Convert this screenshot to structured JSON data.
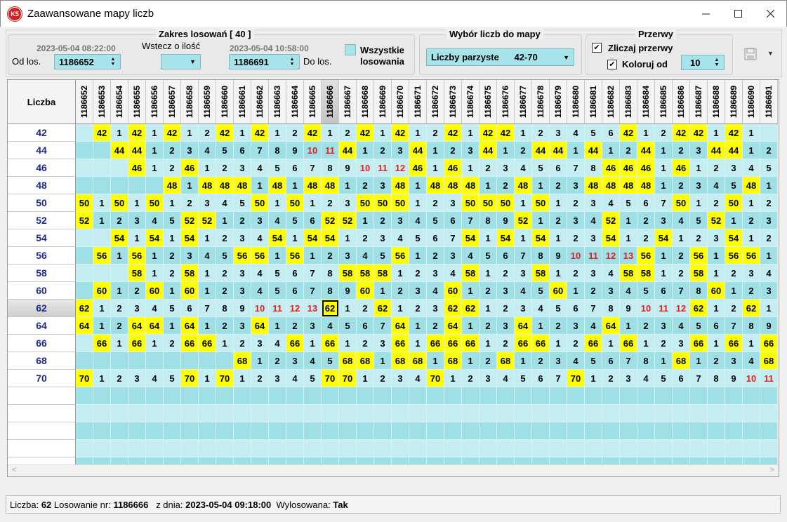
{
  "window": {
    "title": "Zaawansowane mapy liczb",
    "app_icon_text": "K5"
  },
  "range_panel": {
    "title": "Zakres losowań  [ 40 ]",
    "from_date": "2023-05-04 08:22:00",
    "from_label": "Od los.",
    "from_value": "1186652",
    "back_label": "Wstecz o ilość",
    "back_value": "",
    "to_date": "2023-05-04 10:58:00",
    "to_value": "1186691",
    "to_label": "Do los.",
    "all_label_1": "Wszystkie",
    "all_label_2": "losowania"
  },
  "numbers_panel": {
    "title": "Wybór liczb do mapy",
    "selected": "Liczby parzyste      42-70"
  },
  "gaps_panel": {
    "title": "Przerwy",
    "count_gaps_label": "Zliczaj przerwy",
    "count_gaps_checked": true,
    "color_from_label": "Koloruj od",
    "color_from_checked": true,
    "color_from_value": "10"
  },
  "grid": {
    "corner_label": "Liczba",
    "columns": [
      "1186652",
      "1186653",
      "1186654",
      "1186655",
      "1186656",
      "1186657",
      "1186658",
      "1186659",
      "1186660",
      "1186661",
      "1186662",
      "1186663",
      "1186664",
      "1186665",
      "1186666",
      "1186667",
      "1186668",
      "1186669",
      "1186670",
      "1186671",
      "1186672",
      "1186673",
      "1186674",
      "1186675",
      "1186676",
      "1186677",
      "1186678",
      "1186679",
      "1186680",
      "1186681",
      "1186682",
      "1186683",
      "1186684",
      "1186685",
      "1186686",
      "1186687",
      "1186688",
      "1186689",
      "1186690",
      "1186691"
    ],
    "selected_column": 14,
    "selected_row": 10,
    "color_threshold": 10,
    "rows": [
      {
        "num": "42",
        "cells": [
          "",
          "42",
          "1",
          "42",
          "1",
          "42",
          "1",
          "2",
          "42",
          "1",
          "42",
          "1",
          "2",
          "42",
          "1",
          "2",
          "42",
          "1",
          "42",
          "1",
          "2",
          "42",
          "1",
          "42",
          "42",
          "1",
          "2",
          "3",
          "4",
          "5",
          "6",
          "42",
          "1",
          "2",
          "42",
          "42",
          "1",
          "42",
          "1",
          ""
        ]
      },
      {
        "num": "44",
        "cells": [
          "",
          "",
          "44",
          "44",
          "1",
          "2",
          "3",
          "4",
          "5",
          "6",
          "7",
          "8",
          "9",
          "10",
          "11",
          "44",
          "1",
          "2",
          "3",
          "44",
          "1",
          "2",
          "3",
          "44",
          "1",
          "2",
          "44",
          "44",
          "1",
          "44",
          "1",
          "2",
          "44",
          "1",
          "2",
          "3",
          "44",
          "44",
          "1",
          "2"
        ]
      },
      {
        "num": "46",
        "cells": [
          "",
          "",
          "",
          "46",
          "1",
          "2",
          "46",
          "1",
          "2",
          "3",
          "4",
          "5",
          "6",
          "7",
          "8",
          "9",
          "10",
          "11",
          "12",
          "46",
          "1",
          "46",
          "1",
          "2",
          "3",
          "4",
          "5",
          "6",
          "7",
          "8",
          "46",
          "46",
          "46",
          "1",
          "46",
          "1",
          "2",
          "3",
          "4",
          "5"
        ]
      },
      {
        "num": "48",
        "cells": [
          "",
          "",
          "",
          "",
          "",
          "48",
          "1",
          "48",
          "48",
          "48",
          "1",
          "48",
          "1",
          "48",
          "48",
          "1",
          "2",
          "3",
          "48",
          "1",
          "48",
          "48",
          "48",
          "1",
          "2",
          "48",
          "1",
          "2",
          "3",
          "48",
          "48",
          "48",
          "48",
          "1",
          "2",
          "3",
          "4",
          "5",
          "48",
          "1"
        ]
      },
      {
        "num": "50",
        "cells": [
          "50",
          "1",
          "50",
          "1",
          "50",
          "1",
          "2",
          "3",
          "4",
          "5",
          "50",
          "1",
          "50",
          "1",
          "2",
          "3",
          "50",
          "50",
          "50",
          "1",
          "2",
          "3",
          "50",
          "50",
          "50",
          "1",
          "50",
          "1",
          "2",
          "3",
          "4",
          "5",
          "6",
          "7",
          "50",
          "1",
          "2",
          "50",
          "1",
          "2"
        ]
      },
      {
        "num": "52",
        "cells": [
          "52",
          "1",
          "2",
          "3",
          "4",
          "5",
          "52",
          "52",
          "1",
          "2",
          "3",
          "4",
          "5",
          "6",
          "52",
          "52",
          "1",
          "2",
          "3",
          "4",
          "5",
          "6",
          "7",
          "8",
          "9",
          "52",
          "1",
          "2",
          "3",
          "4",
          "52",
          "1",
          "2",
          "3",
          "4",
          "5",
          "52",
          "1",
          "2",
          "3"
        ]
      },
      {
        "num": "54",
        "cells": [
          "",
          "",
          "54",
          "1",
          "54",
          "1",
          "54",
          "1",
          "2",
          "3",
          "4",
          "54",
          "1",
          "54",
          "54",
          "1",
          "2",
          "3",
          "4",
          "5",
          "6",
          "7",
          "54",
          "1",
          "54",
          "1",
          "54",
          "1",
          "2",
          "3",
          "54",
          "1",
          "2",
          "54",
          "1",
          "2",
          "3",
          "54",
          "1",
          "2"
        ]
      },
      {
        "num": "56",
        "cells": [
          "",
          "56",
          "1",
          "56",
          "1",
          "2",
          "3",
          "4",
          "5",
          "56",
          "56",
          "1",
          "56",
          "1",
          "2",
          "3",
          "4",
          "5",
          "56",
          "1",
          "2",
          "3",
          "4",
          "5",
          "6",
          "7",
          "8",
          "9",
          "10",
          "11",
          "12",
          "13",
          "56",
          "1",
          "2",
          "56",
          "1",
          "56",
          "56",
          "1"
        ]
      },
      {
        "num": "58",
        "cells": [
          "",
          "",
          "",
          "58",
          "1",
          "2",
          "58",
          "1",
          "2",
          "3",
          "4",
          "5",
          "6",
          "7",
          "8",
          "58",
          "58",
          "58",
          "1",
          "2",
          "3",
          "4",
          "58",
          "1",
          "2",
          "3",
          "58",
          "1",
          "2",
          "3",
          "4",
          "58",
          "58",
          "1",
          "2",
          "58",
          "1",
          "2",
          "3",
          "4"
        ]
      },
      {
        "num": "60",
        "cells": [
          "",
          "60",
          "1",
          "2",
          "60",
          "1",
          "60",
          "1",
          "2",
          "3",
          "4",
          "5",
          "6",
          "7",
          "8",
          "9",
          "60",
          "1",
          "2",
          "3",
          "4",
          "60",
          "1",
          "2",
          "3",
          "4",
          "5",
          "60",
          "1",
          "2",
          "3",
          "4",
          "5",
          "6",
          "7",
          "8",
          "60",
          "1",
          "2",
          "3"
        ]
      },
      {
        "num": "62",
        "cells": [
          "62",
          "1",
          "2",
          "3",
          "4",
          "5",
          "6",
          "7",
          "8",
          "9",
          "10",
          "11",
          "12",
          "13",
          "62",
          "1",
          "2",
          "62",
          "1",
          "2",
          "3",
          "62",
          "62",
          "1",
          "2",
          "3",
          "4",
          "5",
          "6",
          "7",
          "8",
          "9",
          "10",
          "11",
          "12",
          "62",
          "1",
          "2",
          "62",
          "1"
        ]
      },
      {
        "num": "64",
        "cells": [
          "64",
          "1",
          "2",
          "64",
          "64",
          "1",
          "64",
          "1",
          "2",
          "3",
          "64",
          "1",
          "2",
          "3",
          "4",
          "5",
          "6",
          "7",
          "64",
          "1",
          "2",
          "64",
          "1",
          "2",
          "3",
          "64",
          "1",
          "2",
          "3",
          "4",
          "64",
          "1",
          "2",
          "3",
          "4",
          "5",
          "6",
          "7",
          "8",
          "9"
        ]
      },
      {
        "num": "66",
        "cells": [
          "",
          "66",
          "1",
          "66",
          "1",
          "2",
          "66",
          "66",
          "1",
          "2",
          "3",
          "4",
          "66",
          "1",
          "66",
          "1",
          "2",
          "3",
          "66",
          "1",
          "66",
          "66",
          "66",
          "1",
          "2",
          "66",
          "66",
          "1",
          "2",
          "66",
          "1",
          "66",
          "1",
          "2",
          "3",
          "66",
          "1",
          "66",
          "1",
          "66"
        ]
      },
      {
        "num": "68",
        "cells": [
          "",
          "",
          "",
          "",
          "",
          "",
          "",
          "",
          "",
          "68",
          "1",
          "2",
          "3",
          "4",
          "5",
          "68",
          "68",
          "1",
          "68",
          "68",
          "1",
          "68",
          "1",
          "2",
          "68",
          "1",
          "2",
          "3",
          "4",
          "5",
          "6",
          "7",
          "8",
          "1",
          "68",
          "1",
          "2",
          "3",
          "4",
          "68"
        ]
      },
      {
        "num": "70",
        "cells": [
          "70",
          "1",
          "2",
          "3",
          "4",
          "5",
          "70",
          "1",
          "70",
          "1",
          "2",
          "3",
          "4",
          "5",
          "70",
          "70",
          "1",
          "2",
          "3",
          "4",
          "70",
          "1",
          "2",
          "3",
          "4",
          "5",
          "6",
          "7",
          "70",
          "1",
          "2",
          "3",
          "4",
          "5",
          "6",
          "7",
          "8",
          "9",
          "10",
          "11"
        ]
      }
    ],
    "empty_rows": 5
  },
  "status": {
    "number_label": "Liczba: ",
    "number_value": "62",
    "draw_label": " Losowanie nr: ",
    "draw_value": "1186666",
    "date_label": "   z dnia: ",
    "date_value": "2023-05-04 09:18:00",
    "drawn_label": "  Wylosowana: ",
    "drawn_value": "Tak"
  },
  "colors": {
    "cell_cyan_a": "#c5eef2",
    "cell_cyan_b": "#9ee0e6",
    "hit_yellow": "#ffff00",
    "gap_red": "#e41c1c",
    "row_label_blue": "#1c2a8c"
  }
}
